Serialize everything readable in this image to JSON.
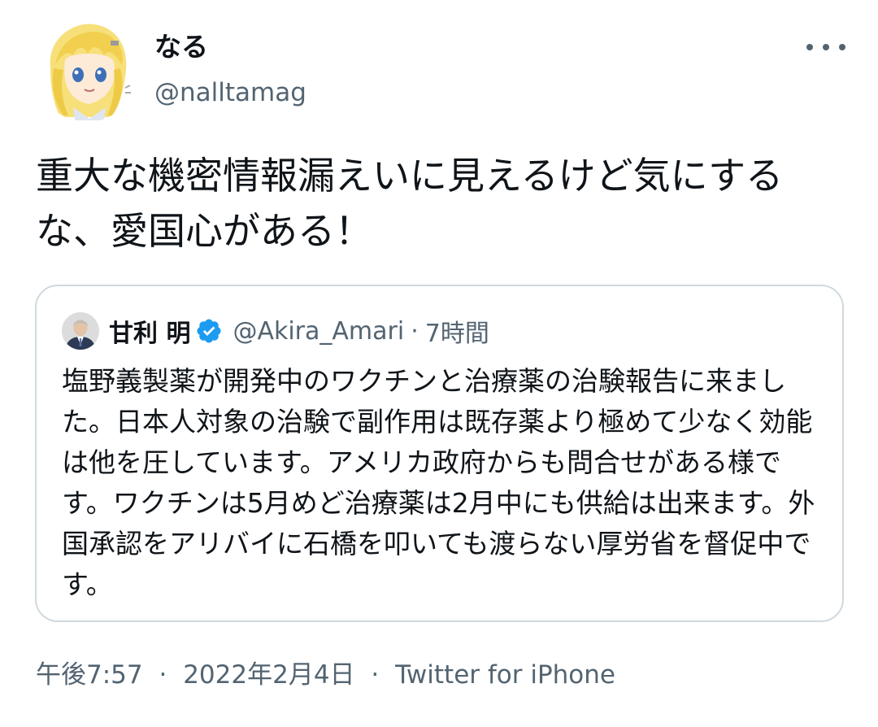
{
  "author": {
    "display_name": "なる",
    "handle": "@nalltamag",
    "avatar_icon": "anime-character-avatar"
  },
  "more_icon": "more-horizontal-icon",
  "tweet": {
    "text": "重大な機密情報漏えいに見えるけど気にするな、愛国心がある！"
  },
  "quoted_tweet": {
    "display_name": "甘利 明",
    "verified_icon": "verified-badge-icon",
    "handle": "@Akira_Amari",
    "separator": "·",
    "time": "7時間",
    "text": "塩野義製薬が開発中のワクチンと治療薬の治験報告に来ました。日本人対象の治験で副作用は既存薬より極めて少なく効能は他を圧しています。アメリカ政府からも問合せがある様です。ワクチンは5月めど治療薬は2月中にも供給は出来ます。外国承認をアリバイに石橋を叩いても渡らない厚労省を督促中です。"
  },
  "meta": {
    "time": "午後7:57",
    "separator1": "·",
    "date": "2022年2月4日",
    "separator2": "·",
    "source": "Twitter for iPhone"
  },
  "colors": {
    "text_primary": "#0f1419",
    "text_secondary": "#536471",
    "border": "#cfd9de",
    "verified": "#1d9bf0"
  }
}
